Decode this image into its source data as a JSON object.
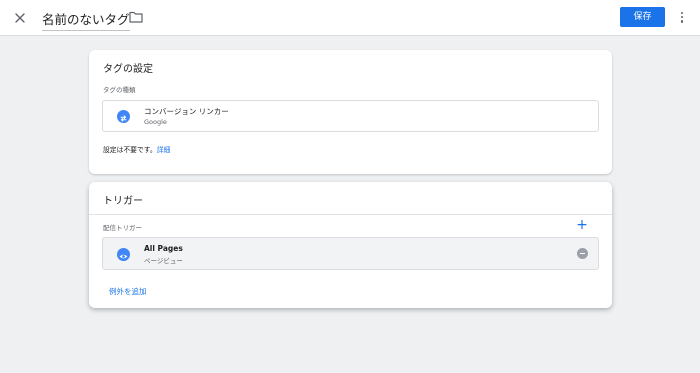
{
  "header": {
    "tag_name": "名前のないタグ",
    "save_label": "保存",
    "close_icon": "close-icon",
    "folder_icon": "folder-icon",
    "more_icon": "more-vert-icon"
  },
  "tag_config": {
    "title": "タグの設定",
    "type_label": "タグの種類",
    "tag_type": {
      "name": "コンバージョン リンカー",
      "vendor": "Google",
      "icon": "conversion-linker-icon",
      "icon_color": "#4285f4"
    },
    "note": "設定は不要です。",
    "details_link": "詳細"
  },
  "triggering": {
    "title": "トリガー",
    "firing_label": "配信トリガー",
    "add_icon": "plus-icon",
    "triggers": [
      {
        "name": "All Pages",
        "type": "ページビュー",
        "icon": "eye-icon"
      }
    ],
    "add_exception": "例外を追加"
  },
  "colors": {
    "accent": "#1a73e8",
    "background": "#eef0f2",
    "card": "#ffffff"
  }
}
